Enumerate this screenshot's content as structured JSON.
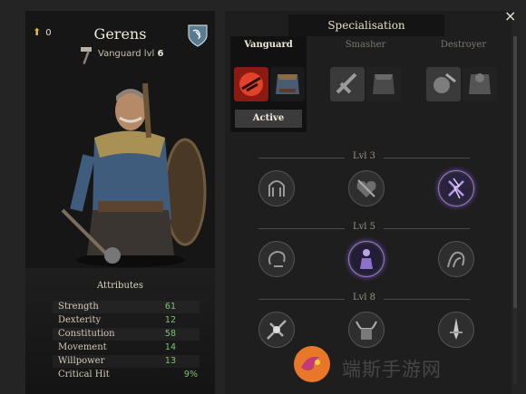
{
  "header": {
    "skill_points": "0"
  },
  "character": {
    "name": "Gerens",
    "class_label": "Vanguard lvl",
    "level": "6"
  },
  "attributes": {
    "title": "Attributes",
    "rows": [
      {
        "label": "Strength",
        "value": "61"
      },
      {
        "label": "Dexterity",
        "value": "12"
      },
      {
        "label": "Constitution",
        "value": "58"
      },
      {
        "label": "Movement",
        "value": "14"
      },
      {
        "label": "Willpower",
        "value": "13"
      },
      {
        "label": "Critical Hit",
        "value": "9%"
      }
    ]
  },
  "specialisation": {
    "title": "Specialisation",
    "tabs": [
      {
        "label": "Vanguard",
        "active": true,
        "status": "Active"
      },
      {
        "label": "Smasher",
        "active": false
      },
      {
        "label": "Destroyer",
        "active": false
      }
    ]
  },
  "levels": [
    {
      "label": "Lvl 3",
      "selected_index": 2
    },
    {
      "label": "Lvl 5",
      "selected_index": 1
    },
    {
      "label": "Lvl 8",
      "selected_index": -1
    }
  ],
  "close_icon": "×",
  "watermark": {
    "text": "端斯手游网"
  },
  "colors": {
    "accent_green": "#7fc36e",
    "selected_purple": "#9a79d8",
    "active_tab_red": "#c0392b"
  }
}
